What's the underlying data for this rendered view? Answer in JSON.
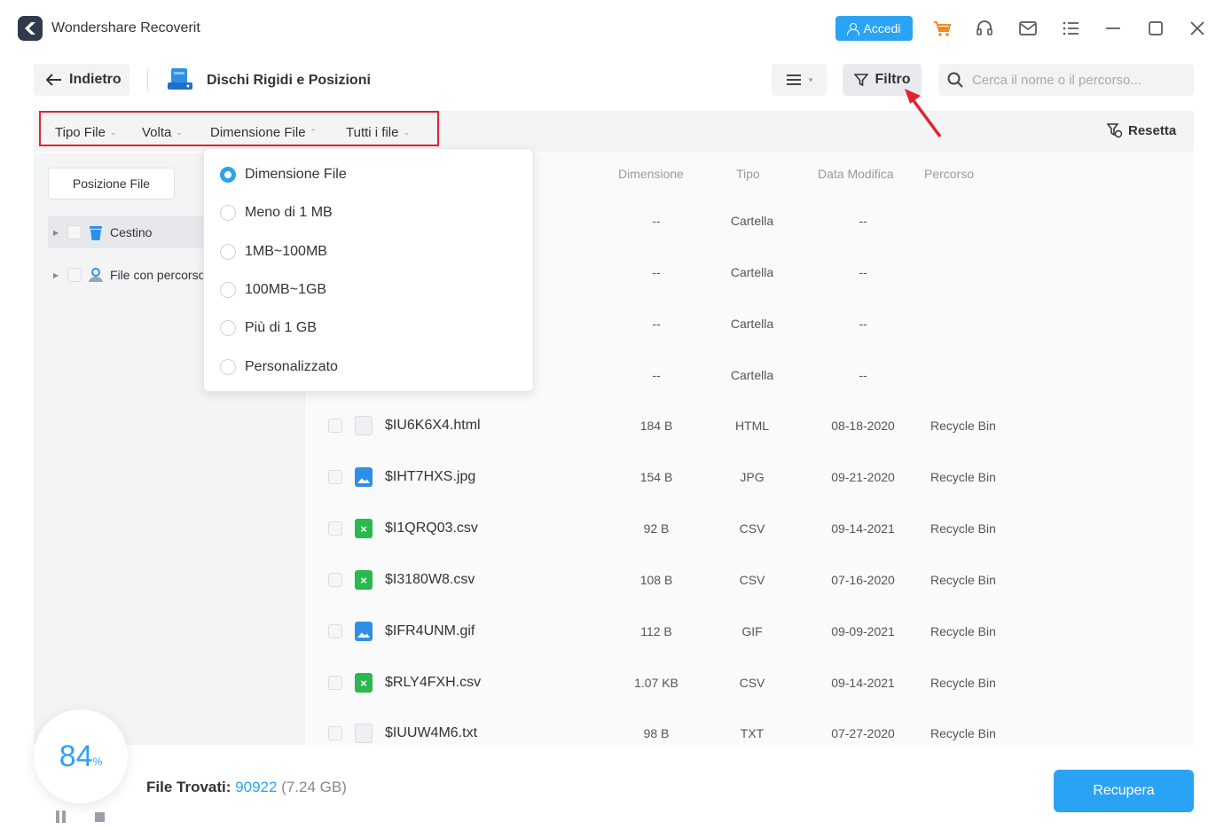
{
  "app": {
    "title": "Wondershare Recoverit"
  },
  "header": {
    "login_label": "Accedi"
  },
  "toolbar": {
    "back_label": "Indietro",
    "location_title": "Dischi Rigidi e Posizioni",
    "filter_label": "Filtro",
    "search_placeholder": "Cerca il nome o il percorso..."
  },
  "filters": {
    "items": [
      "Tipo File",
      "Volta",
      "Dimensione File",
      "Tutti i file"
    ],
    "reset_label": "Resetta"
  },
  "sidebar": {
    "tab_label": "Posizione File",
    "items": [
      {
        "label": "Cestino",
        "icon": "trash-icon"
      },
      {
        "label": "File con percorso",
        "icon": "user-folder-icon"
      }
    ]
  },
  "table": {
    "columns": [
      "Dimensione",
      "Tipo",
      "Data Modifica",
      "Percorso"
    ],
    "folder_rows": [
      {
        "size": "--",
        "type": "Cartella",
        "date": "--"
      },
      {
        "size": "--",
        "type": "Cartella",
        "date": "--"
      },
      {
        "size": "--",
        "type": "Cartella",
        "date": "--"
      },
      {
        "size": "--",
        "type": "Cartella",
        "date": "--"
      }
    ],
    "file_rows": [
      {
        "name": "$IU6K6X4.html",
        "icon": "html",
        "size": "184 B",
        "type": "HTML",
        "date": "08-18-2020",
        "path": "Recycle Bin"
      },
      {
        "name": "$IHT7HXS.jpg",
        "icon": "jpg",
        "size": "154 B",
        "type": "JPG",
        "date": "09-21-2020",
        "path": "Recycle Bin"
      },
      {
        "name": "$I1QRQ03.csv",
        "icon": "csv",
        "size": "92 B",
        "type": "CSV",
        "date": "09-14-2021",
        "path": "Recycle Bin"
      },
      {
        "name": "$I3180W8.csv",
        "icon": "csv",
        "size": "108 B",
        "type": "CSV",
        "date": "07-16-2020",
        "path": "Recycle Bin"
      },
      {
        "name": "$IFR4UNM.gif",
        "icon": "gif",
        "size": "112 B",
        "type": "GIF",
        "date": "09-09-2021",
        "path": "Recycle Bin"
      },
      {
        "name": "$RLY4FXH.csv",
        "icon": "csv",
        "size": "1.07 KB",
        "type": "CSV",
        "date": "09-14-2021",
        "path": "Recycle Bin"
      },
      {
        "name": "$IUUW4M6.txt",
        "icon": "txt",
        "size": "98 B",
        "type": "TXT",
        "date": "07-27-2020",
        "path": "Recycle Bin"
      }
    ]
  },
  "dropdown": {
    "options": [
      {
        "label": "Dimensione File",
        "checked": true
      },
      {
        "label": "Meno di 1 MB",
        "checked": false
      },
      {
        "label": "1MB~100MB",
        "checked": false
      },
      {
        "label": "100MB~1GB",
        "checked": false
      },
      {
        "label": "Più di 1 GB",
        "checked": false
      },
      {
        "label": "Personalizzato",
        "checked": false
      }
    ]
  },
  "status": {
    "progress_value": "84",
    "progress_unit": "%",
    "found_label": "File Trovati:",
    "found_count": "90922",
    "found_size": "(7.24 GB)",
    "recover_label": "Recupera"
  },
  "colors": {
    "accent": "#2ba3f4",
    "highlight": "#e0242f"
  }
}
